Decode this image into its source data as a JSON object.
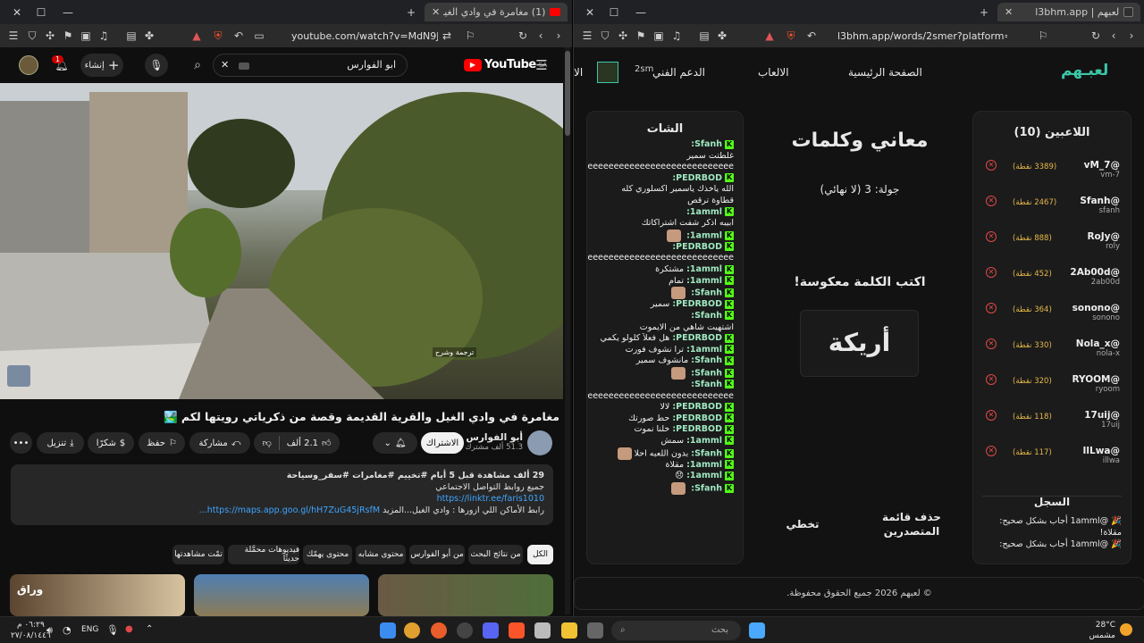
{
  "left_browser": {
    "tab_title": "(1) مغامرة في وادي الغيل والقر",
    "url": "youtube.com/watch?v=MdN9JD26098",
    "youtube": {
      "logo_text": "YouTube",
      "country_code": "SA",
      "search_value": "ابو الفوارس",
      "create_label": "إنشاء",
      "notification_count": "1",
      "caption_overlay": "ترجمة وشرح",
      "video_title": "مغامرة في وادي الغيل والقرية القديمة وقصة من ذكرياتي رويتها لكم 🏞️",
      "channel_name": "أبو الفوارس",
      "subscribers": "51.3 ألف مشترك",
      "subscribe_label": "الاشتراك",
      "likes": "2.1 ألف",
      "share_label": "مشاركة",
      "save_label": "حفظ",
      "thanks_label": "شكرًا",
      "download_label": "تنزيل",
      "description": {
        "meta": "29 ألف مشاهدة  قبل 5 أيام  #تخييم #مغامرات #سفر_وسياحة",
        "line2": "جميع روابط التواصل الاجتماعي",
        "link1": "https://linktr.ee/faris1010",
        "line4_text": "رابط الأماكن اللي ازورها : وادي الغيل...المزيد",
        "link2": "https://maps.app.goo.gl/hH7ZuG45jRsfM..."
      },
      "chips": [
        "الكل",
        "من نتائج البحث",
        "من أبو الفوارس",
        "محتوى مشابه",
        "محتوى يهمّك",
        "فيديوهات محمَّلة حديثًا",
        "تمّت مشاهدتها"
      ],
      "thumb_label": "وراق"
    }
  },
  "right_browser": {
    "tab_title": "لعبهم | l3bhm.app",
    "url": "l3bhm.app/words/2smer?platform=kick",
    "site": {
      "logo": "لعبـهم",
      "nav": [
        "الصفحة الرئيسية",
        "الالعاب",
        "الدعم الفني",
        "الا"
      ],
      "streamer": "2sm",
      "players_title": "اللاعبين (10)",
      "players": [
        {
          "name": "@vM_7",
          "sub": "vm-7",
          "points": "(3389 نقطة)"
        },
        {
          "name": "@Sfanh",
          "sub": "sfanh",
          "points": "(2467 نقطة)"
        },
        {
          "name": "@RoJy",
          "sub": "roly",
          "points": "(888 نقطة)"
        },
        {
          "name": "@2Ab00d",
          "sub": "2ab00d",
          "points": "(452 نقطة)"
        },
        {
          "name": "@sonono",
          "sub": "sonono",
          "points": "(364 نقطة)"
        },
        {
          "name": "@Nola_x",
          "sub": "nola-x",
          "points": "(330 نقطة)"
        },
        {
          "name": "@RYOOM",
          "sub": "ryoom",
          "points": "(320 نقطة)"
        },
        {
          "name": "@17uij",
          "sub": "17uij",
          "points": "(118 نقطة)"
        },
        {
          "name": "@IlLwa",
          "sub": "illwa",
          "points": "(117 نقطة)"
        }
      ],
      "log_title": "السجل",
      "log": [
        "🎉 @1amml أجاب بشكل صحيح: مقلاة!",
        "🎉 @1amml أجاب بشكل صحيح:"
      ],
      "game_title": "معاني وكلمات",
      "round": "جولة: 3 (لا نهائي)",
      "instruction": "اكتب الكلمة معكوسة!",
      "word": "أريكة",
      "skip_label": "تخطي",
      "delete_board_label": "حذف قائمة المتصدرين",
      "chat_title": "الشات",
      "chat": [
        {
          "user": "Sfanh:",
          "msg": ""
        },
        {
          "user": "",
          "msg": "غلطتت سمير"
        },
        {
          "user": "",
          "msg": "4eeeeeeeeeeeeeeeeeeeeeeeeeeeeeeeeeeeeeeeeeeeeeeee"
        },
        {
          "user": "PEDRBOD:",
          "msg": ""
        },
        {
          "user": "",
          "msg": "الله ياخذك ياسمير اكسلوري كله"
        },
        {
          "user": "",
          "msg": "قطاوة ترقص"
        },
        {
          "user": "1amml:",
          "msg": ""
        },
        {
          "user": "",
          "msg": "ابيبه اذكر شفت اشتراكاتك"
        },
        {
          "user": "1amml:",
          "msg": "",
          "emoji": true
        },
        {
          "user": "PEDRBOD:",
          "msg": ""
        },
        {
          "user": "",
          "msg": "4eeeeeeeeeeeeeeeeeeeeeeeeeeeeeeeeeeeeeeeeeeeeeeee"
        },
        {
          "user": "1amml:",
          "msg": "مشتكرة"
        },
        {
          "user": "1amml:",
          "msg": "تمام"
        },
        {
          "user": "Sfanh:",
          "msg": "",
          "emoji": true
        },
        {
          "user": "PEDRBOD:",
          "msg": "سمير"
        },
        {
          "user": "Sfanh:",
          "msg": ""
        },
        {
          "user": "",
          "msg": "اشتهيت شاهي من الايموت"
        },
        {
          "user": "PEDRBOD:",
          "msg": "هل فعلاً كلولو يكمي"
        },
        {
          "user": "1amml:",
          "msg": "ترا نشوف فورت"
        },
        {
          "user": "Sfanh:",
          "msg": "مانشوف سمير"
        },
        {
          "user": "Sfanh:",
          "msg": "",
          "emoji": true
        },
        {
          "user": "Sfanh:",
          "msg": ""
        },
        {
          "user": "",
          "msg": "4eeeeeeeeeeeeeeeeeeeeeeeeeeeeeeeeeeeeeeeeeeeeeeee"
        },
        {
          "user": "PEDRBOD:",
          "msg": "لالا"
        },
        {
          "user": "PEDRBOD:",
          "msg": "حط صورتك"
        },
        {
          "user": "PEDRBOD:",
          "msg": "خلنا نموت"
        },
        {
          "user": "1amml:",
          "msg": "سمش"
        },
        {
          "user": "Sfanh:",
          "msg": "بدون اللعبه احلا",
          "emoji": true
        },
        {
          "user": "1amml:",
          "msg": "مقلاة"
        },
        {
          "user": "1amml:",
          "msg": "😞"
        },
        {
          "user": "Sfanh:",
          "msg": "",
          "emoji": true
        }
      ],
      "footer": "© لعبهم 2026 جميع الحقوق محفوظة."
    }
  },
  "taskbar": {
    "time": "٠٦:٢٩ م",
    "date": "٢٧/٠٨/١٤٤٦",
    "lang": "ENG",
    "search_placeholder": "بحث",
    "weather_temp": "28°C",
    "weather_desc": "مشمس"
  },
  "colors": {
    "kick_green": "#53fc18",
    "link_blue": "#3ea6ff",
    "points_gold": "#e6b94a",
    "remove_red": "#e04848",
    "youtube_red": "#ff0000"
  }
}
